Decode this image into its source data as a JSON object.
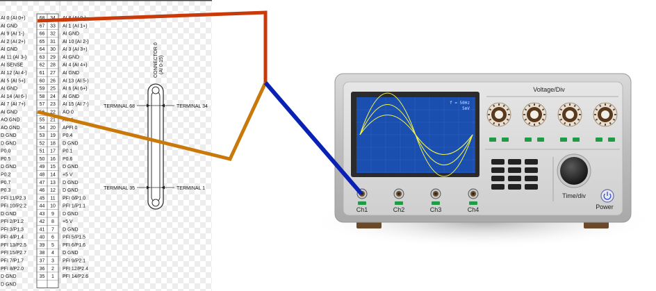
{
  "connector": {
    "title": "CONNECTOR 0",
    "subtitle": "(AI 0-15)",
    "terminals": {
      "t68": "TERMINAL 68",
      "t34": "TERMINAL 34",
      "t35": "TERMINAL 35",
      "t1": "TERMINAL 1"
    },
    "left_labels": [
      "AI 0 (AI 0+)",
      "AI GND",
      "AI 9 (AI 1-)",
      "AI 2 (AI 2+)",
      "AI GND",
      "AI 11 (AI 3-)",
      "AI SENSE",
      "AI 12 (AI 4-)",
      "AI 5 (AI 5+)",
      "AI GND",
      "AI 14 (AI 6-)",
      "AI 7 (AI 7+)",
      "AI GND",
      "AO GND",
      "AO GND",
      "D GND",
      "D GND",
      "P0.0",
      "P0.5",
      "D GND",
      "P0.2",
      "P0.7",
      "P0.3",
      "PFI 11/P2.3",
      "PFI 10/P2.2",
      "D GND",
      "PFI 2/P1.2",
      "PFI 3/P1.3",
      "PFI 4/P1.4",
      "PFI 13/P2.5",
      "PFI 15/P2.7",
      "PFI 7/P1.7",
      "PFI 8/P2.0",
      "D GND",
      "D GND"
    ],
    "left_nums": [
      "68",
      "67",
      "66",
      "65",
      "64",
      "63",
      "62",
      "61",
      "60",
      "59",
      "58",
      "57",
      "56",
      "55",
      "54",
      "53",
      "52",
      "51",
      "50",
      "49",
      "48",
      "47",
      "46",
      "45",
      "44",
      "43",
      "42",
      "41",
      "40",
      "39",
      "38",
      "37",
      "36",
      "35"
    ],
    "right_nums": [
      "34",
      "33",
      "32",
      "31",
      "30",
      "29",
      "28",
      "27",
      "26",
      "25",
      "24",
      "23",
      "22",
      "21",
      "20",
      "19",
      "18",
      "17",
      "16",
      "15",
      "14",
      "13",
      "12",
      "11",
      "10",
      "9",
      "8",
      "7",
      "6",
      "5",
      "4",
      "3",
      "2",
      "1"
    ],
    "right_labels": [
      "AI 8 (AI 0-)",
      "AI 1 (AI 1+)",
      "AI GND",
      "AI 10 (AI 2-)",
      "AI 3 (AI 3+)",
      "AI GND",
      "AI 4 (AI 4+)",
      "AI GND",
      "AI 13 (AI 5-)",
      "AI 6 (AI 6+)",
      "AI GND",
      "AI 15 (AI 7-)",
      "AO 0",
      "AO 1",
      "APFI 0",
      "P0.4",
      "D GND",
      "P0.1",
      "P0.6",
      "D GND",
      "+5 V",
      "D GND",
      "D GND",
      "PFI 0/P1.0",
      "PFI 1/P1.1",
      "D GND",
      "+5 V",
      "D GND",
      "PFI 5/P1.5",
      "PFI 6/P1.6",
      "D GND",
      "PFI 9/P2.1",
      "PFI 12/P2.4",
      "PFI 14/P2.6"
    ]
  },
  "scope": {
    "title": "Voltage/Div",
    "timediv": "Time/div",
    "power": "Power",
    "readout1": "f = 50Hz",
    "readout2": "5mV",
    "channels": [
      "Ch1",
      "Ch2",
      "Ch3",
      "Ch4"
    ]
  },
  "colors": {
    "wire_red": "#c83a0a",
    "wire_orange": "#c8790a",
    "wire_blue": "#0a22b4",
    "screen": "#1a4fb0",
    "trace": "#f2f24a"
  }
}
